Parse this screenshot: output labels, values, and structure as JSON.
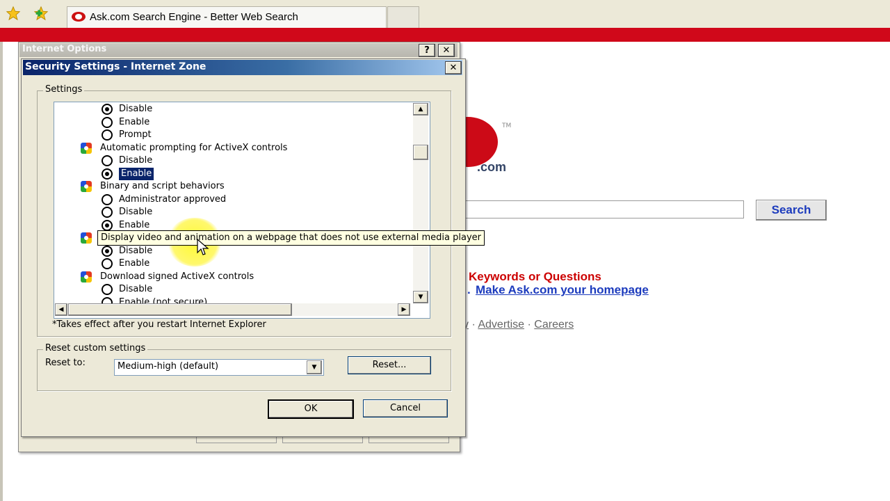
{
  "browser": {
    "tab_title": "Ask.com Search Engine - Better Web Search",
    "favorites_icon": "star-icon",
    "add_favorites_icon": "star-plus-icon",
    "brand_color": "#d0081a"
  },
  "page": {
    "logo_suffix": ".com",
    "logo_tm": "TM",
    "search_button": "Search",
    "keywords_text": "Keywords or Questions",
    "homepage_link": "Make Ask.com your homepage",
    "footer_partial": "y",
    "footer_links": [
      "Advertise",
      "Careers"
    ]
  },
  "internet_options": {
    "title": "Internet Options",
    "help_button": "?",
    "close_button": "✕"
  },
  "security_dialog": {
    "title": "Security Settings - Internet Zone",
    "close_button": "✕",
    "settings_group_label": "Settings",
    "settings_items": [
      {
        "kind": "option",
        "label": "Disable",
        "checked": true
      },
      {
        "kind": "option",
        "label": "Enable",
        "checked": false
      },
      {
        "kind": "option",
        "label": "Prompt",
        "checked": false
      },
      {
        "kind": "category",
        "label": "Automatic prompting for ActiveX controls"
      },
      {
        "kind": "option",
        "label": "Disable",
        "checked": false
      },
      {
        "kind": "option",
        "label": "Enable",
        "checked": true,
        "selected": true
      },
      {
        "kind": "category",
        "label": "Binary and script behaviors"
      },
      {
        "kind": "option",
        "label": "Administrator approved",
        "checked": false
      },
      {
        "kind": "option",
        "label": "Disable",
        "checked": false
      },
      {
        "kind": "option",
        "label": "Enable",
        "checked": true
      },
      {
        "kind": "category",
        "label": "Display video and animation on a webpage that does not use external media player"
      },
      {
        "kind": "option",
        "label": "Disable",
        "checked": true
      },
      {
        "kind": "option",
        "label": "Enable",
        "checked": false
      },
      {
        "kind": "category",
        "label": "Download signed ActiveX controls"
      },
      {
        "kind": "option",
        "label": "Disable",
        "checked": false
      },
      {
        "kind": "option",
        "label": "Enable (not secure)",
        "checked": false
      }
    ],
    "tooltip": "Display video and animation on a webpage that does not use external media player",
    "restart_note": "*Takes effect after you restart Internet Explorer",
    "reset_group_label": "Reset custom settings",
    "reset_to_label": "Reset to:",
    "reset_to_value": "Medium-high (default)",
    "reset_button": "Reset...",
    "ok_button": "OK",
    "cancel_button": "Cancel"
  }
}
